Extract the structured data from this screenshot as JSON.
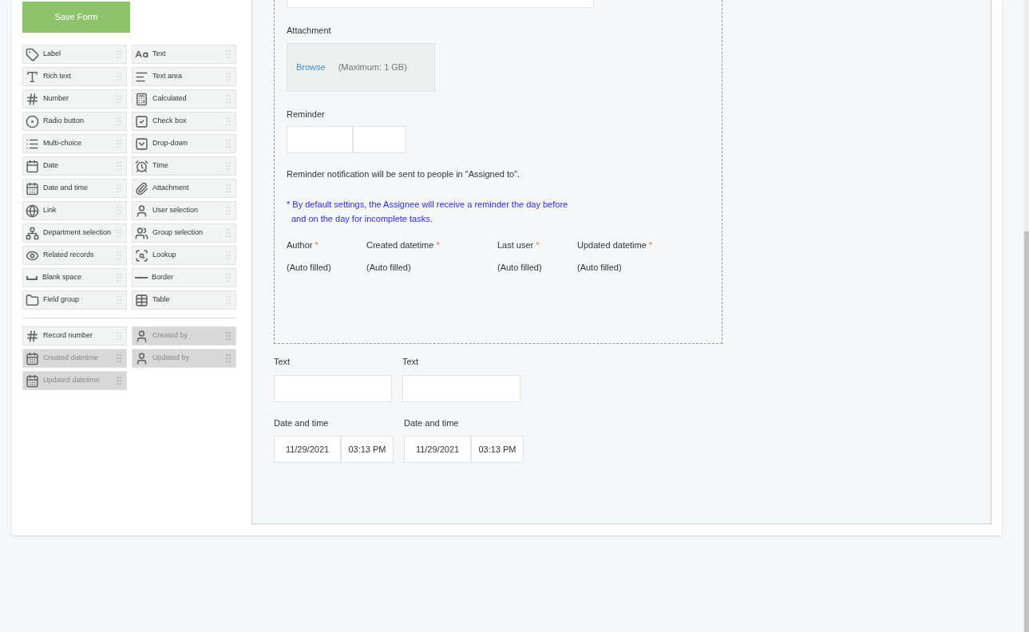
{
  "save_button": "Save Form",
  "palette": [
    {
      "label": "Label"
    },
    {
      "label": "Text"
    },
    {
      "label": "Rich text"
    },
    {
      "label": "Text area"
    },
    {
      "label": "Number"
    },
    {
      "label": "Calculated"
    },
    {
      "label": "Radio button"
    },
    {
      "label": "Check box"
    },
    {
      "label": "Multi-choice"
    },
    {
      "label": "Drop-down"
    },
    {
      "label": "Date"
    },
    {
      "label": "Time"
    },
    {
      "label": "Date and time"
    },
    {
      "label": "Attachment"
    },
    {
      "label": "Link"
    },
    {
      "label": "User selection"
    },
    {
      "label": "Department selection"
    },
    {
      "label": "Group selection"
    },
    {
      "label": "Related records"
    },
    {
      "label": "Lookup"
    },
    {
      "label": "Blank space"
    },
    {
      "label": "Border"
    },
    {
      "label": "Field group"
    },
    {
      "label": "Table"
    }
  ],
  "system_fields": [
    {
      "label": "Record number",
      "disabled": false
    },
    {
      "label": "Created by",
      "disabled": true
    },
    {
      "label": "Created datetime",
      "disabled": true
    },
    {
      "label": "Updated by",
      "disabled": true
    },
    {
      "label": "Updated datetime",
      "disabled": true
    }
  ],
  "group": {
    "attachment": {
      "label": "Attachment",
      "browse": "Browse",
      "limit": "(Maximum: 1 GB)"
    },
    "reminder": {
      "label": "Reminder",
      "note": "Reminder notification will be sent to people in \"Assigned to\".",
      "hint_lines": [
        "* By default settings, the Assignee will receive a reminder the day before",
        "and on the day for incomplete tasks."
      ]
    },
    "auto_fields": [
      {
        "label": "Author",
        "required_mark": "*",
        "value": "(Auto filled)"
      },
      {
        "label": "Created datetime",
        "required_mark": "*",
        "value": "(Auto filled)"
      },
      {
        "label": "Last user",
        "required_mark": "*",
        "value": "(Auto filled)"
      },
      {
        "label": "Updated datetime",
        "required_mark": "*",
        "value": "(Auto filled)"
      }
    ]
  },
  "text_fields": [
    {
      "label": "Text"
    },
    {
      "label": "Text"
    }
  ],
  "datetime_fields": [
    {
      "label": "Date and time",
      "date": "11/29/2021",
      "time": "03:13 PM"
    },
    {
      "label": "Date and time",
      "date": "11/29/2021",
      "time": "03:13 PM"
    }
  ]
}
